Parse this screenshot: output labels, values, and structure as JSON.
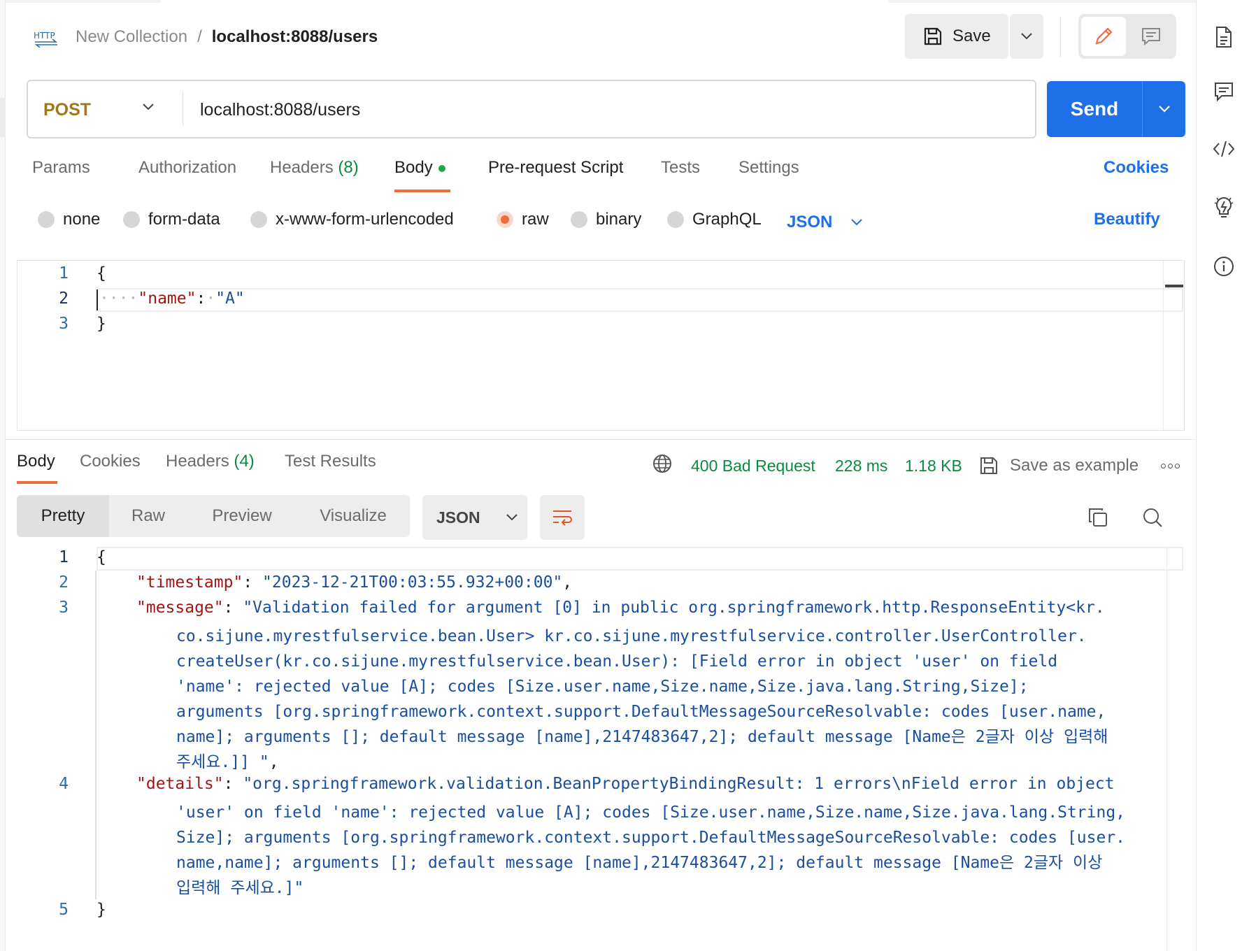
{
  "breadcrumb": {
    "icon": "HTTP",
    "collection": "New Collection",
    "separator": "/",
    "request": "localhost:8088/users"
  },
  "header": {
    "save_label": "Save"
  },
  "request": {
    "method": "POST",
    "url": "localhost:8088/users",
    "send_label": "Send"
  },
  "request_tabs": {
    "params": "Params",
    "authorization": "Authorization",
    "headers": "Headers",
    "headers_count": "(8)",
    "body": "Body",
    "pre_request": "Pre-request Script",
    "tests": "Tests",
    "settings": "Settings",
    "cookies": "Cookies"
  },
  "body_types": {
    "none": "none",
    "form_data": "form-data",
    "urlencoded": "x-www-form-urlencoded",
    "raw": "raw",
    "binary": "binary",
    "graphql": "GraphQL",
    "format": "JSON",
    "beautify": "Beautify",
    "selected": "raw"
  },
  "request_body": {
    "line_numbers": [
      "1",
      "2",
      "3"
    ],
    "open_brace": "{",
    "key": "\"name\"",
    "colon": ":",
    "value": "\"A\"",
    "close_brace": "}"
  },
  "response_tabs": {
    "body": "Body",
    "cookies": "Cookies",
    "headers": "Headers",
    "headers_count": "(4)",
    "test_results": "Test Results"
  },
  "response_meta": {
    "status": "400 Bad Request",
    "time": "228 ms",
    "size": "1.18 KB",
    "save_example": "Save as example"
  },
  "response_view": {
    "pretty": "Pretty",
    "raw": "Raw",
    "preview": "Preview",
    "visualize": "Visualize",
    "format": "JSON"
  },
  "response_body": {
    "line_numbers": [
      "1",
      "2",
      "3",
      "4",
      "5"
    ],
    "open_brace": "{",
    "close_brace": "}",
    "timestamp_key": "\"timestamp\"",
    "timestamp_value": "\"2023-12-21T00:03:55.932+00:00\"",
    "message_key": "\"message\"",
    "message_lines": [
      "\"Validation failed for argument [0] in public org.springframework.http.ResponseEntity<kr.",
      "co.sijune.myrestfulservice.bean.User> kr.co.sijune.myrestfulservice.controller.UserController.",
      "createUser(kr.co.sijune.myrestfulservice.bean.User): [Field error in object 'user' on field",
      "'name': rejected value [A]; codes [Size.user.name,Size.name,Size.java.lang.String,Size];",
      "arguments [org.springframework.context.support.DefaultMessageSourceResolvable: codes [user.name,",
      "name]; arguments []; default message [name],2147483647,2]; default message [Name은 2글자 이상 입력해",
      "주세요.]] \""
    ],
    "details_key": "\"details\"",
    "details_lines": [
      "\"org.springframework.validation.BeanPropertyBindingResult: 1 errors\\nField error in object",
      "'user' on field 'name': rejected value [A]; codes [Size.user.name,Size.name,Size.java.lang.String,",
      "Size]; arguments [org.springframework.context.support.DefaultMessageSourceResolvable: codes [user.",
      "name,name]; arguments []; default message [name],2147483647,2]; default message [Name은 2글자 이상",
      "입력해 주세요.]\""
    ]
  },
  "colors": {
    "accent": "#f26b3a",
    "primary": "#1f6fe8",
    "status_error_text": "#0c8a3e",
    "method": "#a0781a"
  }
}
